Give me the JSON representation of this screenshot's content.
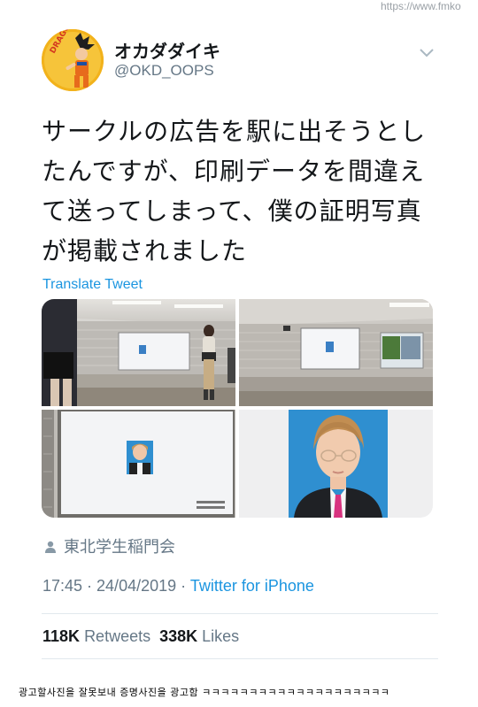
{
  "watermark": "https://www.fmko",
  "tweet": {
    "display_name": "オカダダイキ",
    "handle": "@OKD_OOPS",
    "text_lines": [
      "サークルの広告を駅に出そうとし",
      "たんですが、印刷データを間違え",
      "て送ってしまって、僕の証明写真",
      "が掲載されました"
    ],
    "translate_label": "Translate Tweet",
    "account": "東北学生稲門会",
    "time": "17:45 · 24/04/2019 · ",
    "source": "Twitter for iPhone",
    "retweets_count": "118K",
    "retweets_label": "Retweets",
    "likes_count": "338K",
    "likes_label": "Likes",
    "avatar_text": "DRAGON BALL"
  },
  "colors": {
    "link": "#1b95e0",
    "secondary_text": "#657786",
    "avatar_bg": "#f2b21b",
    "id_photo_bg": "#2f8fd0"
  },
  "caption": "광고할사진을 잘못보내 증명사진을 광고함 ㅋㅋㅋㅋㅋㅋㅋㅋㅋㅋㅋㅋㅋㅋㅋㅋㅋㅋㅋㅋ"
}
